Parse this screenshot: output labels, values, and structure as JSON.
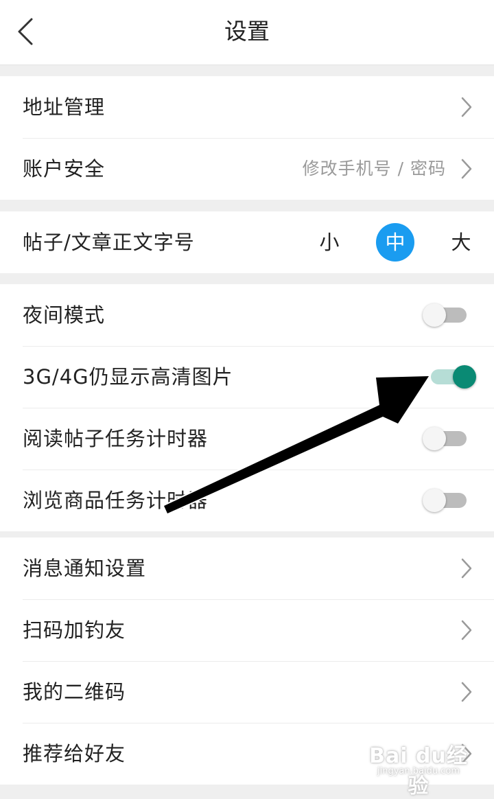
{
  "header": {
    "title": "设置"
  },
  "section1": {
    "items": [
      {
        "label": "地址管理"
      },
      {
        "label": "账户安全",
        "sub": "修改手机号 / 密码"
      }
    ]
  },
  "font_size": {
    "label": "帖子/文章正文字号",
    "options": [
      "小",
      "中",
      "大"
    ],
    "selected": "中"
  },
  "toggles": {
    "items": [
      {
        "label": "夜间模式",
        "on": false
      },
      {
        "label": "3G/4G仍显示高清图片",
        "on": true
      },
      {
        "label": "阅读帖子任务计时器",
        "on": false
      },
      {
        "label": "浏览商品任务计时器",
        "on": false
      }
    ]
  },
  "section4": {
    "items": [
      {
        "label": "消息通知设置"
      },
      {
        "label": "扫码加钓友"
      },
      {
        "label": "我的二维码"
      },
      {
        "label": "推荐给好友"
      }
    ]
  },
  "watermark": {
    "brand": "Bai du经验",
    "url": "jingyan.baidu.com"
  },
  "colors": {
    "accent_blue": "#1a9cf0",
    "toggle_on": "#0a8a74",
    "toggle_on_track": "#b6ddd6",
    "toggle_off_track": "#bcbcbc",
    "annotation_arrow": "#000000"
  },
  "icons": {
    "back": "chevron-left-icon",
    "row_arrow": "chevron-right-icon",
    "annotation": "arrow-annotation-icon",
    "watermark": "paw-icon"
  }
}
